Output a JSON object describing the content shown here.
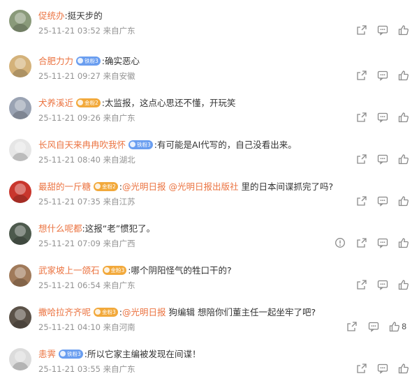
{
  "colors": {
    "username": "#eb7340",
    "text": "#333333",
    "meta": "#939393",
    "icon": "#8a8a8a",
    "badge_blue": "#6a9ef0",
    "badge_gold": "#f2a93b"
  },
  "comments": [
    {
      "username": "促统办",
      "text": "挺天步的",
      "time": "25-11-21 03:52",
      "location": "来自广东",
      "avatar_color": "#8a9a7a"
    },
    {
      "username": "合肥力力",
      "badge": "铁粉3",
      "text": "确实恶心",
      "time": "25-11-21 09:27",
      "location": "来自安徽",
      "avatar_color": "#d4b27a"
    },
    {
      "username": "犬养溪近",
      "badge": "金粉2",
      "text": "太监报，这点心思还不懂，开玩笑",
      "time": "25-11-21 09:26",
      "location": "来自广东",
      "avatar_color": "#9aa3b3"
    },
    {
      "username": "长风自天来冉冉吹我怀",
      "badge": "铁粉3",
      "text": "有可能是AI代写的，自己没看出来。",
      "time": "25-11-21 08:40",
      "location": "来自湖北",
      "avatar_color": "#e6e6e6"
    },
    {
      "username": "最甜的一斤糖",
      "badge": "金粉2",
      "mentions": [
        "@光明日报",
        "@光明日报出版社"
      ],
      "text": "里的日本间谍抓完了吗?",
      "time": "25-11-21 07:35",
      "location": "来自江苏",
      "avatar_color": "#c9362d"
    },
    {
      "username": "想什么呢都",
      "text": "这报“老”惯犯了。",
      "time": "25-11-21 07:09",
      "location": "来自广西",
      "avatar_color": "#4d5a4d"
    },
    {
      "username": "武家坡上一颌石",
      "badge": "金粉3",
      "text": "哪个阴阳怪气的牲口干的?",
      "time": "25-11-21 06:54",
      "location": "来自广东",
      "avatar_color": "#a07a5a"
    },
    {
      "username": "撒哈拉齐齐呢",
      "badge": "金粉3",
      "mentions": [
        "@光明日报"
      ],
      "text": "狗编辑 想陪你们董主任一起坐牢了吧?",
      "time": "25-11-21 04:10",
      "location": "来自河南",
      "avatar_color": "#5b5248",
      "likes": "8"
    },
    {
      "username": "恚霁",
      "badge": "铁粉3",
      "text": "所以它家主编被发现在间谍！",
      "time": "25-11-21 03:55",
      "location": "来自广东",
      "avatar_color": "#dcdcdc"
    }
  ],
  "icons": {
    "share": "share-icon",
    "comment": "comment-icon",
    "like": "like-icon",
    "report": "report-icon"
  }
}
